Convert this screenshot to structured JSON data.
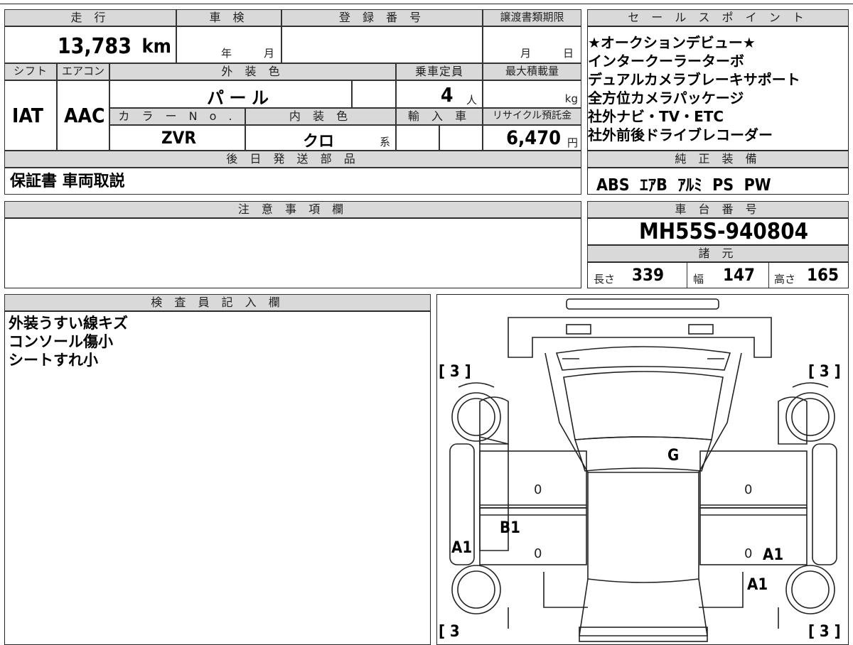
{
  "top": {
    "mileage_label": "走 行",
    "mileage_value": "13,783",
    "mileage_unit": "km",
    "shaken_label": "車 検",
    "shaken_year": "年",
    "shaken_month": "月",
    "reg_label": "登 録 番 号",
    "transfer_label": "譲渡書類期限",
    "transfer_month": "月",
    "transfer_day": "日",
    "shift_label": "シフト",
    "shift_value": "IAT",
    "ac_label": "エアコン",
    "ac_value": "AAC",
    "exterior_label": "外 装 色",
    "exterior_value": "パ ー ル",
    "capacity_label": "乗車定員",
    "capacity_value": "4",
    "capacity_unit": "人",
    "maxload_label": "最大積載量",
    "maxload_unit": "kg",
    "colorno_label": "カ ラ ー N o .",
    "colorno_value": "ZVR",
    "interior_label": "内 装 色",
    "interior_value": "クロ",
    "interior_unit": "系",
    "import_label": "輸 入 車",
    "recycle_label": "リサイクル預託金",
    "recycle_value": "6,470",
    "recycle_unit": "円"
  },
  "later_parts": {
    "label": "後 日 発 送 部 品",
    "value": "保証書 車両取説"
  },
  "sales_points": {
    "label": "セ ー ル ス ポ イ ン ト",
    "items": [
      "★オークションデビュー★",
      "インタークーラーターボ",
      "デュアルカメラブレーキサポート",
      "全方位カメラパッケージ",
      "社外ナビ・TV・ETC",
      "社外前後ドライブレコーダー"
    ]
  },
  "equipment": {
    "label": "純 正 装 備",
    "value": "ABS  ｴｱB  ｱﾙﾐ  PS  PW"
  },
  "notes": {
    "label": "注 意 事 項 欄"
  },
  "chassis": {
    "label": "車 台 番 号",
    "value": "MH55S-940804"
  },
  "specs": {
    "label": "諸 元",
    "length_label": "長さ",
    "length_value": "339",
    "width_label": "幅",
    "width_value": "147",
    "height_label": "高さ",
    "height_value": "165"
  },
  "inspector": {
    "label": "検 査 員 記 入 欄",
    "lines": [
      "外装うすい線キズ",
      "コンソール傷小",
      "シートすれ小"
    ]
  },
  "diagram": {
    "tl": "[ 3 ]",
    "tr": "[ 3 ]",
    "bl": "[ 3",
    "br": "[ 3 ]",
    "g": "G",
    "b1": "B1",
    "a1_left": "A1",
    "a1_right_1": "A1",
    "a1_right_2": "A1",
    "zero_1": "0",
    "zero_2": "0",
    "zero_3": "0",
    "zero_4": "0"
  }
}
